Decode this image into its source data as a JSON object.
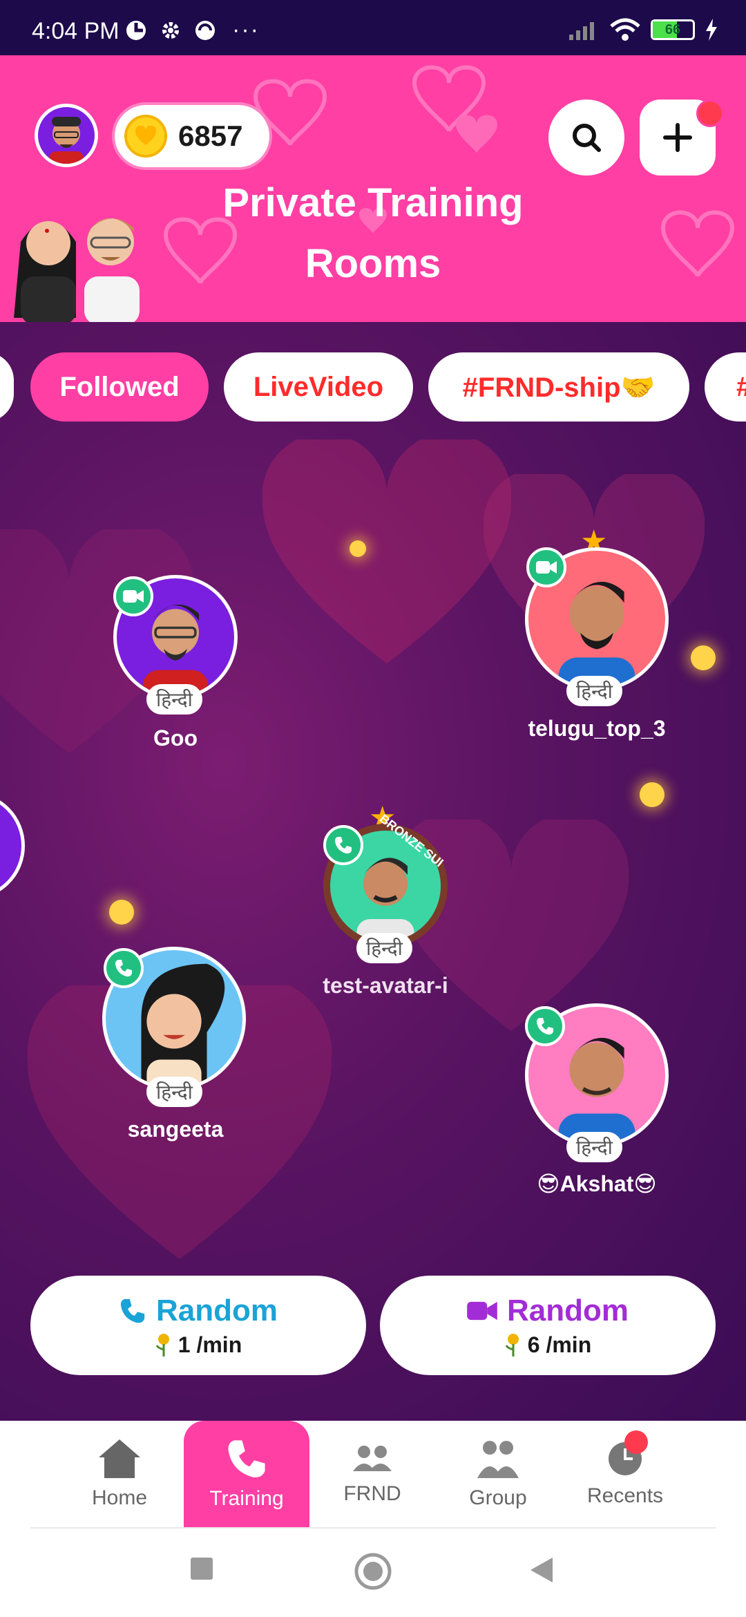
{
  "status_bar": {
    "time": "4:04 PM",
    "battery": "66",
    "icons": [
      "badge-icon",
      "gear-icon",
      "sync-icon",
      "signal-icon",
      "wifi-icon",
      "battery-icon",
      "charging-icon"
    ]
  },
  "header": {
    "coins": "6857",
    "title_line1": "Private Training",
    "title_line2": "Rooms"
  },
  "chips": [
    {
      "label": "Followed",
      "active": true
    },
    {
      "label": "LiveVideo",
      "active": false
    },
    {
      "label": "#FRND-ship🤝",
      "active": false
    }
  ],
  "users": [
    {
      "name": "Goo",
      "lang": "हिन्दी",
      "call_type": "video"
    },
    {
      "name": "telugu_top_3",
      "lang": "हिन्दी",
      "call_type": "video"
    },
    {
      "name": "test-avatar-i",
      "lang": "हिन्दी",
      "call_type": "audio",
      "badge_text": "BRONZE SUPER FR"
    },
    {
      "name": "sangeeta",
      "lang": "हिन्दी",
      "call_type": "audio"
    },
    {
      "name": "😎Akshat😎",
      "lang": "हिन्दी",
      "call_type": "audio"
    }
  ],
  "random_buttons": [
    {
      "label": "Random",
      "price": "1 /min",
      "kind": "audio",
      "color": "#1aa3d6"
    },
    {
      "label": "Random",
      "price": "6 /min",
      "kind": "video",
      "color": "#a22dd6"
    }
  ],
  "bottom_nav": [
    {
      "label": "Home",
      "active": false
    },
    {
      "label": "Training",
      "active": true
    },
    {
      "label": "FRND",
      "active": false
    },
    {
      "label": "Group",
      "active": false
    },
    {
      "label": "Recents",
      "active": false
    }
  ],
  "colors": {
    "brand_pink": "#ff3fa4",
    "status_bar": "#1c0a4a",
    "call_green": "#22c080"
  }
}
